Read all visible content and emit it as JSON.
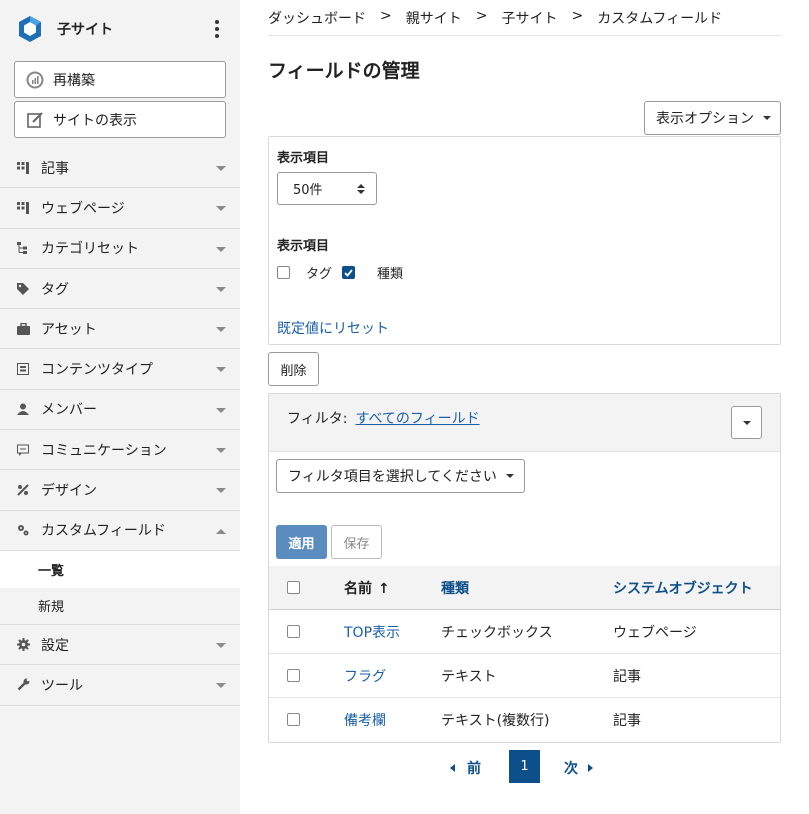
{
  "site": {
    "name": "子サイト"
  },
  "sidebar": {
    "rebuild_label": "再構築",
    "view_site_label": "サイトの表示",
    "items": [
      {
        "label": "記事",
        "icon": "entries-icon"
      },
      {
        "label": "ウェブページ",
        "icon": "pages-icon"
      },
      {
        "label": "カテゴリセット",
        "icon": "category-set-icon"
      },
      {
        "label": "タグ",
        "icon": "tag-icon"
      },
      {
        "label": "アセット",
        "icon": "asset-icon"
      },
      {
        "label": "コンテンツタイプ",
        "icon": "content-type-icon"
      },
      {
        "label": "メンバー",
        "icon": "member-icon"
      },
      {
        "label": "コミュニケーション",
        "icon": "communication-icon"
      },
      {
        "label": "デザイン",
        "icon": "design-icon"
      },
      {
        "label": "カスタムフィールド",
        "icon": "custom-field-icon"
      }
    ],
    "sub_items": [
      {
        "label": "一覧"
      },
      {
        "label": "新規"
      }
    ],
    "bottom_items": [
      {
        "label": "設定",
        "icon": "gear-icon"
      },
      {
        "label": "ツール",
        "icon": "wrench-icon"
      }
    ]
  },
  "breadcrumb": {
    "items": [
      "ダッシュボード",
      "親サイト",
      "子サイト",
      "カスタムフィールド"
    ],
    "separator": ">"
  },
  "page": {
    "title": "フィールドの管理"
  },
  "display_options": {
    "button_label": "表示オプション",
    "limit_label": "表示項目",
    "limit_value": "50件",
    "columns_label": "表示項目",
    "columns": [
      {
        "label": "タグ",
        "checked": false
      },
      {
        "label": "種類",
        "checked": true
      }
    ],
    "reset_label": "既定値にリセット"
  },
  "actions": {
    "delete_label": "削除"
  },
  "filter": {
    "label": "フィルタ:",
    "current": "すべてのフィールド",
    "select_placeholder": "フィルタ項目を選択してください",
    "apply_label": "適用",
    "save_label": "保存"
  },
  "table": {
    "headers": {
      "name": "名前",
      "sort_arrow": "↑",
      "type": "種類",
      "system_object": "システムオブジェクト"
    },
    "rows": [
      {
        "name": "TOP表示",
        "type": "チェックボックス",
        "system_object": "ウェブページ"
      },
      {
        "name": "フラグ",
        "type": "テキスト",
        "system_object": "記事"
      },
      {
        "name": "備考欄",
        "type": "テキスト(複数行)",
        "system_object": "記事"
      }
    ]
  },
  "pagination": {
    "prev_label": "前",
    "current_page": "1",
    "next_label": "次"
  },
  "colors": {
    "accent": "#0d4f8b",
    "link": "#1a5fa8",
    "apply": "#5b8cc0"
  }
}
